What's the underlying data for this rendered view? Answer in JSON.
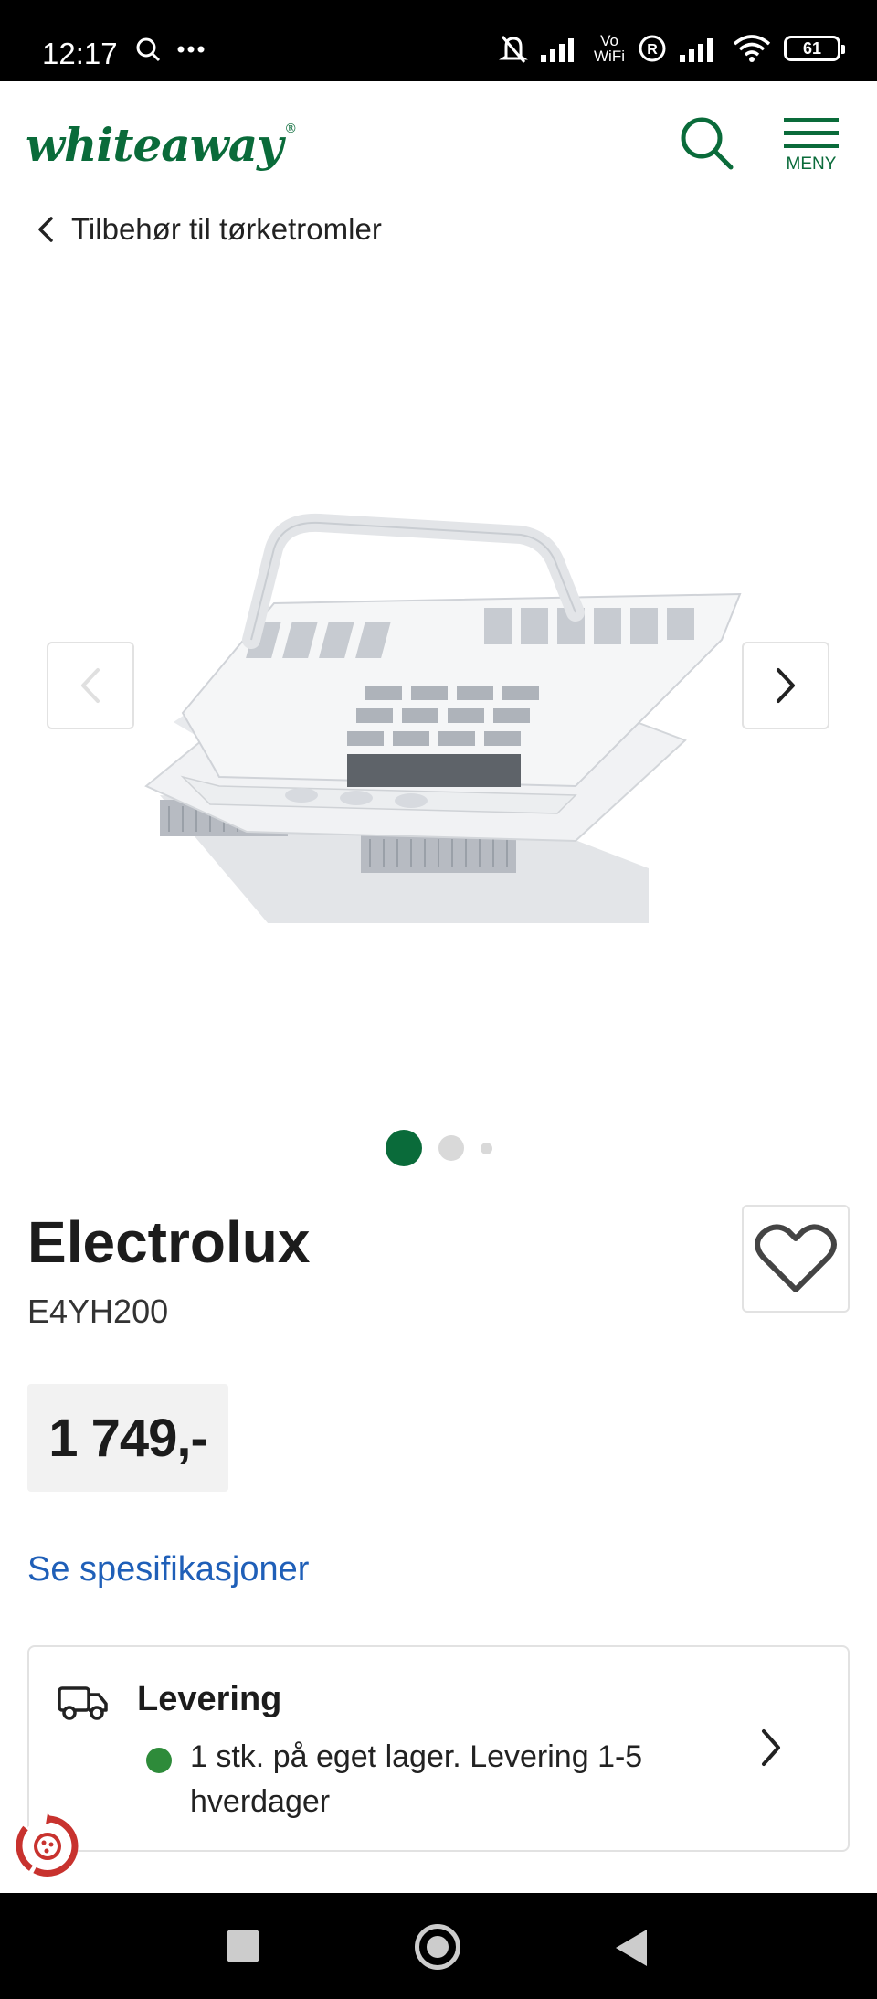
{
  "status_bar": {
    "time": "12:17",
    "vowifi_top": "Vo",
    "vowifi_bottom": "WiFi",
    "battery": "61"
  },
  "header": {
    "logo": "whiteaway",
    "logo_mark": "®",
    "menu_label": "MENY",
    "brand_color": "#0a6b3a"
  },
  "breadcrumb": {
    "label": "Tilbehør til tørketromler"
  },
  "gallery": {
    "slide_count": 3,
    "active_index": 0
  },
  "product": {
    "brand": "Electrolux",
    "model": "E4YH200",
    "price": "1 749,-",
    "spec_link": "Se spesifikasjoner"
  },
  "delivery": {
    "title": "Levering",
    "status": "1 stk. på eget lager. Levering 1-5 hverdager",
    "status_color": "#2e8b3a"
  }
}
